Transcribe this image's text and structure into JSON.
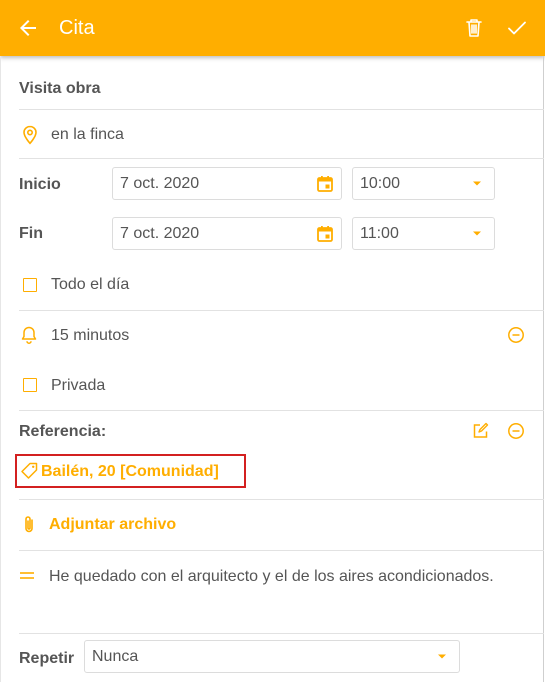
{
  "header": {
    "title": "Cita"
  },
  "form": {
    "title_value": "Visita obra",
    "location_value": "en la finca",
    "start": {
      "label": "Inicio",
      "date": "7 oct. 2020",
      "time": "10:00"
    },
    "end": {
      "label": "Fin",
      "date": "7 oct. 2020",
      "time": "11:00"
    },
    "all_day_label": "Todo el día",
    "reminder_value": "15 minutos",
    "private_label": "Privada",
    "reference_label": "Referencia:",
    "reference_value": "Bailén, 20 [Comunidad]",
    "attach_label": "Adjuntar archivo",
    "notes_value": "He quedado con el arquitecto y el de los aires acondicionados.",
    "repeat_label": "Repetir",
    "repeat_value": "Nunca"
  },
  "colors": {
    "accent": "#FFAE00",
    "highlight_border": "#D32020"
  },
  "icons": [
    "arrow-back-icon",
    "trash-icon",
    "check-icon",
    "location-pin-icon",
    "calendar-icon",
    "dropdown-arrow-icon",
    "bell-icon",
    "minus-circle-icon",
    "edit-icon",
    "tag-icon",
    "paperclip-icon",
    "notes-icon"
  ]
}
